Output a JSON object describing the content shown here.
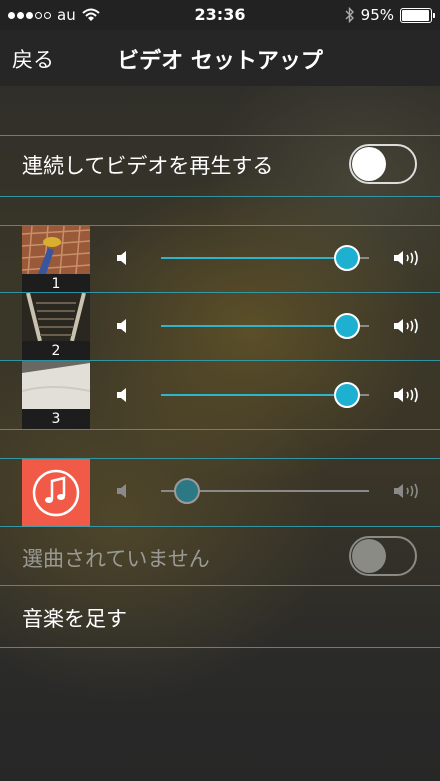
{
  "status_bar": {
    "carrier": "au",
    "time": "23:36",
    "battery_percent": "95%",
    "battery_level": 0.95
  },
  "nav": {
    "back_label": "戻る",
    "title": "ビデオ セットアップ"
  },
  "continuous_play": {
    "label": "連続してビデオを再生する",
    "on": false
  },
  "videos": [
    {
      "number": "1",
      "volume": 0.95
    },
    {
      "number": "2",
      "volume": 0.95
    },
    {
      "number": "3",
      "volume": 0.95
    }
  ],
  "music": {
    "volume": 0.07,
    "status_label": "選曲されていません",
    "status_on": false,
    "add_label": "音楽を足す",
    "icon_color": "#f05a47"
  },
  "colors": {
    "accent": "#2cb5cc",
    "separator": "#2fa6b8"
  }
}
